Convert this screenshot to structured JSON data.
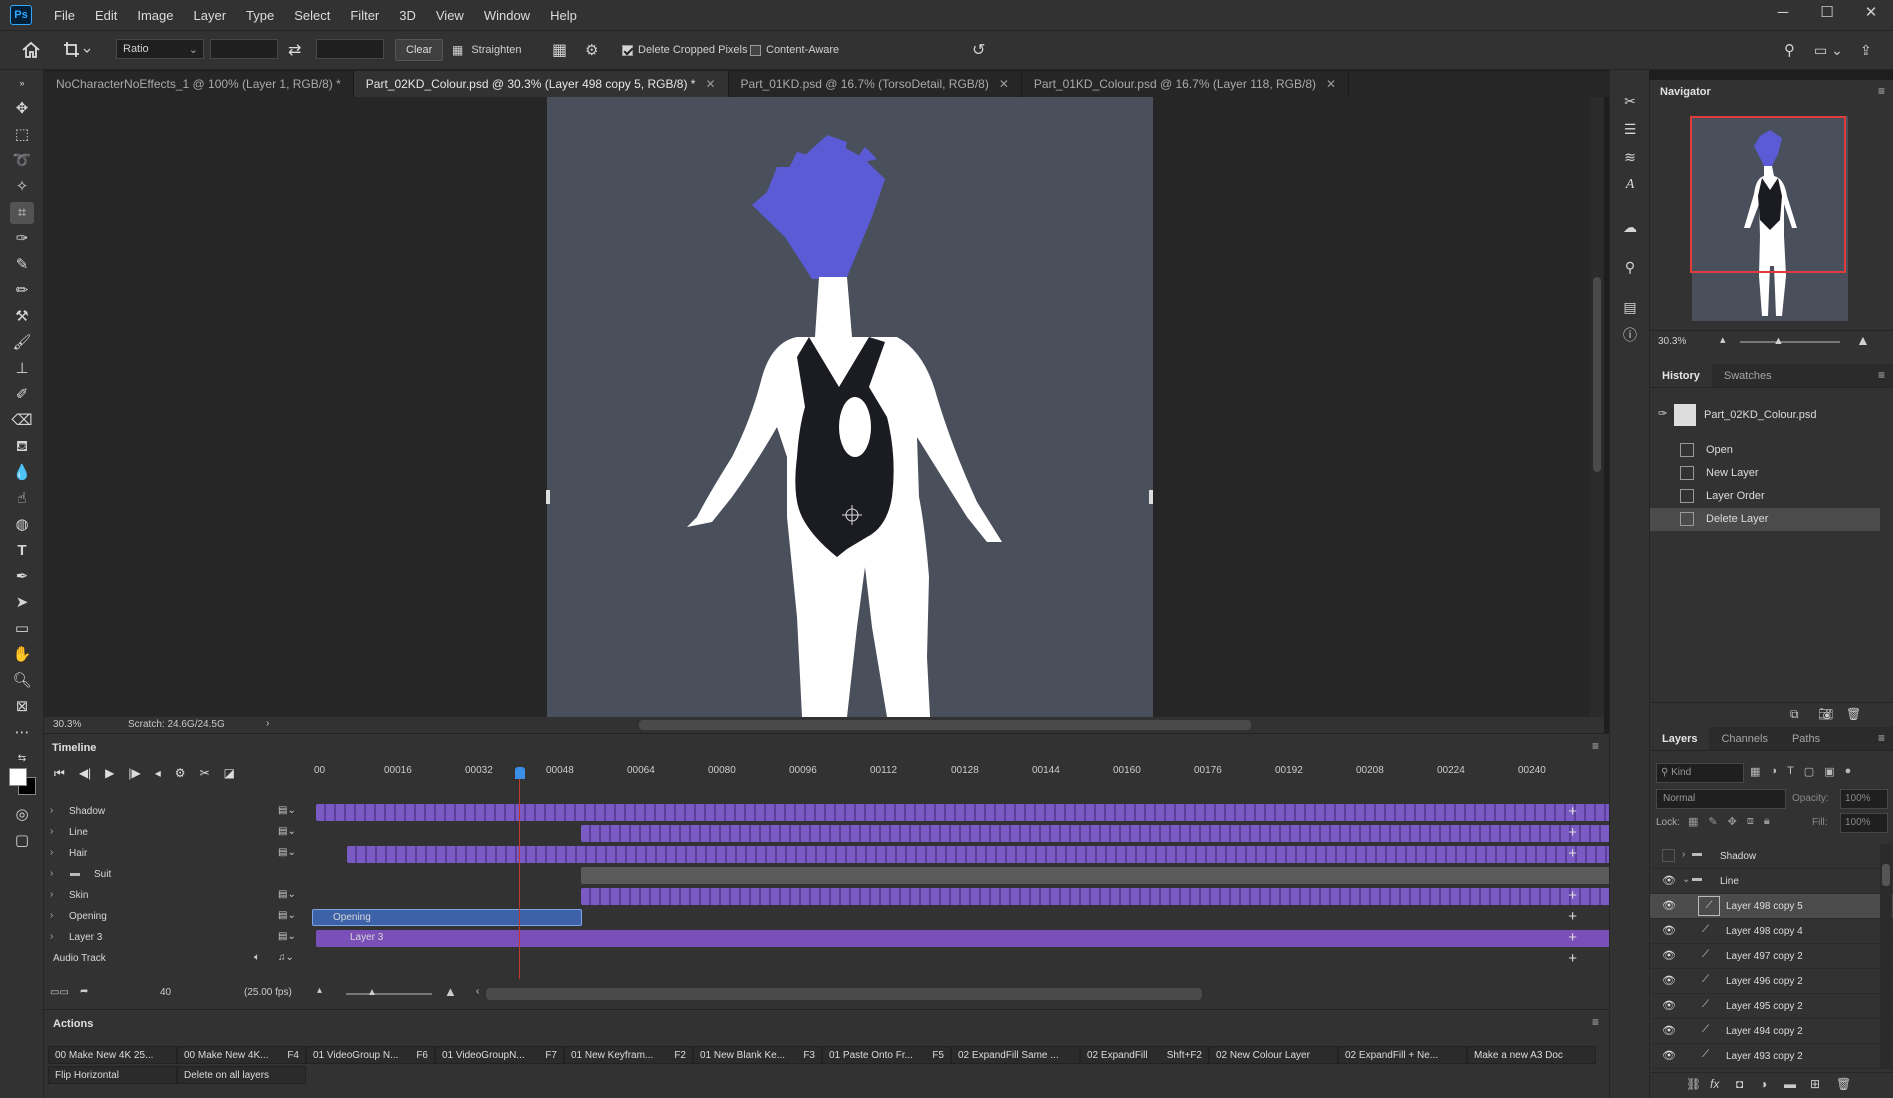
{
  "app": {
    "logo": "Ps",
    "menus": [
      "File",
      "Edit",
      "Image",
      "Layer",
      "Type",
      "Select",
      "Filter",
      "3D",
      "View",
      "Window",
      "Help"
    ],
    "window_controls": [
      "─",
      "☐",
      "✕"
    ]
  },
  "options_bar": {
    "ratio_select": "Ratio",
    "clear_label": "Clear",
    "straighten_label": "Straighten",
    "delete_cropped_label": "Delete Cropped Pixels",
    "content_aware_label": "Content-Aware"
  },
  "tabs": [
    {
      "label": "NoCharacterNoEffects_1 @ 100% (Layer 1, RGB/8) *",
      "active": false
    },
    {
      "label": "Part_02KD_Colour.psd @ 30.3% (Layer 498 copy 5, RGB/8) *",
      "active": true
    },
    {
      "label": "Part_01KD.psd @ 16.7% (TorsoDetail, RGB/8)",
      "active": false
    },
    {
      "label": "Part_01KD_Colour.psd @ 16.7% (Layer 118, RGB/8)",
      "active": false
    }
  ],
  "status": {
    "zoom": "30.3%",
    "scratch": "Scratch: 24.6G/24.5G"
  },
  "timeline": {
    "title": "Timeline",
    "ruler": [
      "00",
      "00016",
      "00032",
      "00048",
      "00064",
      "00080",
      "00096",
      "00112",
      "00128",
      "00144",
      "00160",
      "00176",
      "00192",
      "00208",
      "00224",
      "00240"
    ],
    "tracks": [
      {
        "name": "Shadow"
      },
      {
        "name": "Line"
      },
      {
        "name": "Hair"
      },
      {
        "name": "Suit"
      },
      {
        "name": "Skin"
      },
      {
        "name": "Opening"
      },
      {
        "name": "Layer 3"
      },
      {
        "name": "Audio Track"
      }
    ],
    "clip_opening": "Opening",
    "clip_layer3": "Layer 3",
    "frame_value": "40",
    "fps": "(25.00 fps)",
    "playhead_frame": 40
  },
  "actions": {
    "title": "Actions",
    "row1": [
      {
        "name": "00 Make New 4K 25...",
        "key": ""
      },
      {
        "name": "00 Make New 4K...",
        "key": "F4"
      },
      {
        "name": "01 VideoGroup N...",
        "key": "F6"
      },
      {
        "name": "01 VideoGroupN...",
        "key": "F7"
      },
      {
        "name": "01 New Keyfram...",
        "key": "F2"
      },
      {
        "name": "01 New Blank Ke...",
        "key": "F3"
      },
      {
        "name": "01 Paste Onto Fr...",
        "key": "F5"
      },
      {
        "name": "02 ExpandFill Same ...",
        "key": ""
      },
      {
        "name": "02 ExpandFill",
        "key": "Shft+F2"
      },
      {
        "name": "02 New Colour Layer",
        "key": ""
      },
      {
        "name": "02 ExpandFill + Ne...",
        "key": ""
      },
      {
        "name": "Make a new A3 Doc",
        "key": ""
      }
    ],
    "row2": [
      {
        "name": "Flip Horizontal",
        "key": ""
      },
      {
        "name": "Delete on all layers",
        "key": ""
      }
    ]
  },
  "navigator": {
    "title": "Navigator",
    "zoom": "30.3%"
  },
  "history": {
    "tabs": [
      "History",
      "Swatches"
    ],
    "snapshot": "Part_02KD_Colour.psd",
    "items": [
      "Open",
      "New Layer",
      "Layer Order",
      "Delete Layer"
    ],
    "active_index": 3
  },
  "layers": {
    "tabs": [
      "Layers",
      "Channels",
      "Paths"
    ],
    "filter_placeholder": "Kind",
    "blend_mode": "Normal",
    "opacity_label": "Opacity:",
    "opacity_value": "100%",
    "lock_label": "Lock:",
    "fill_label": "Fill:",
    "fill_value": "100%",
    "rows": [
      {
        "name": "Shadow",
        "type": "group",
        "visible": false
      },
      {
        "name": "Line",
        "type": "group",
        "visible": true
      },
      {
        "name": "Layer 498 copy 5",
        "type": "layer",
        "visible": true,
        "active": true
      },
      {
        "name": "Layer 498 copy 4",
        "type": "layer",
        "visible": true
      },
      {
        "name": "Layer 497 copy 2",
        "type": "layer",
        "visible": true
      },
      {
        "name": "Layer 496 copy 2",
        "type": "layer",
        "visible": true
      },
      {
        "name": "Layer 495 copy 2",
        "type": "layer",
        "visible": true
      },
      {
        "name": "Layer 494 copy 2",
        "type": "layer",
        "visible": true
      },
      {
        "name": "Layer 493 copy 2",
        "type": "layer",
        "visible": true
      }
    ]
  },
  "colors": {
    "accent": "#31a8ff",
    "frames": "#7a5bc4",
    "hair": "#5b5bd6",
    "doc_bg": "#4a4f5c",
    "playhead": "#c0392b"
  }
}
